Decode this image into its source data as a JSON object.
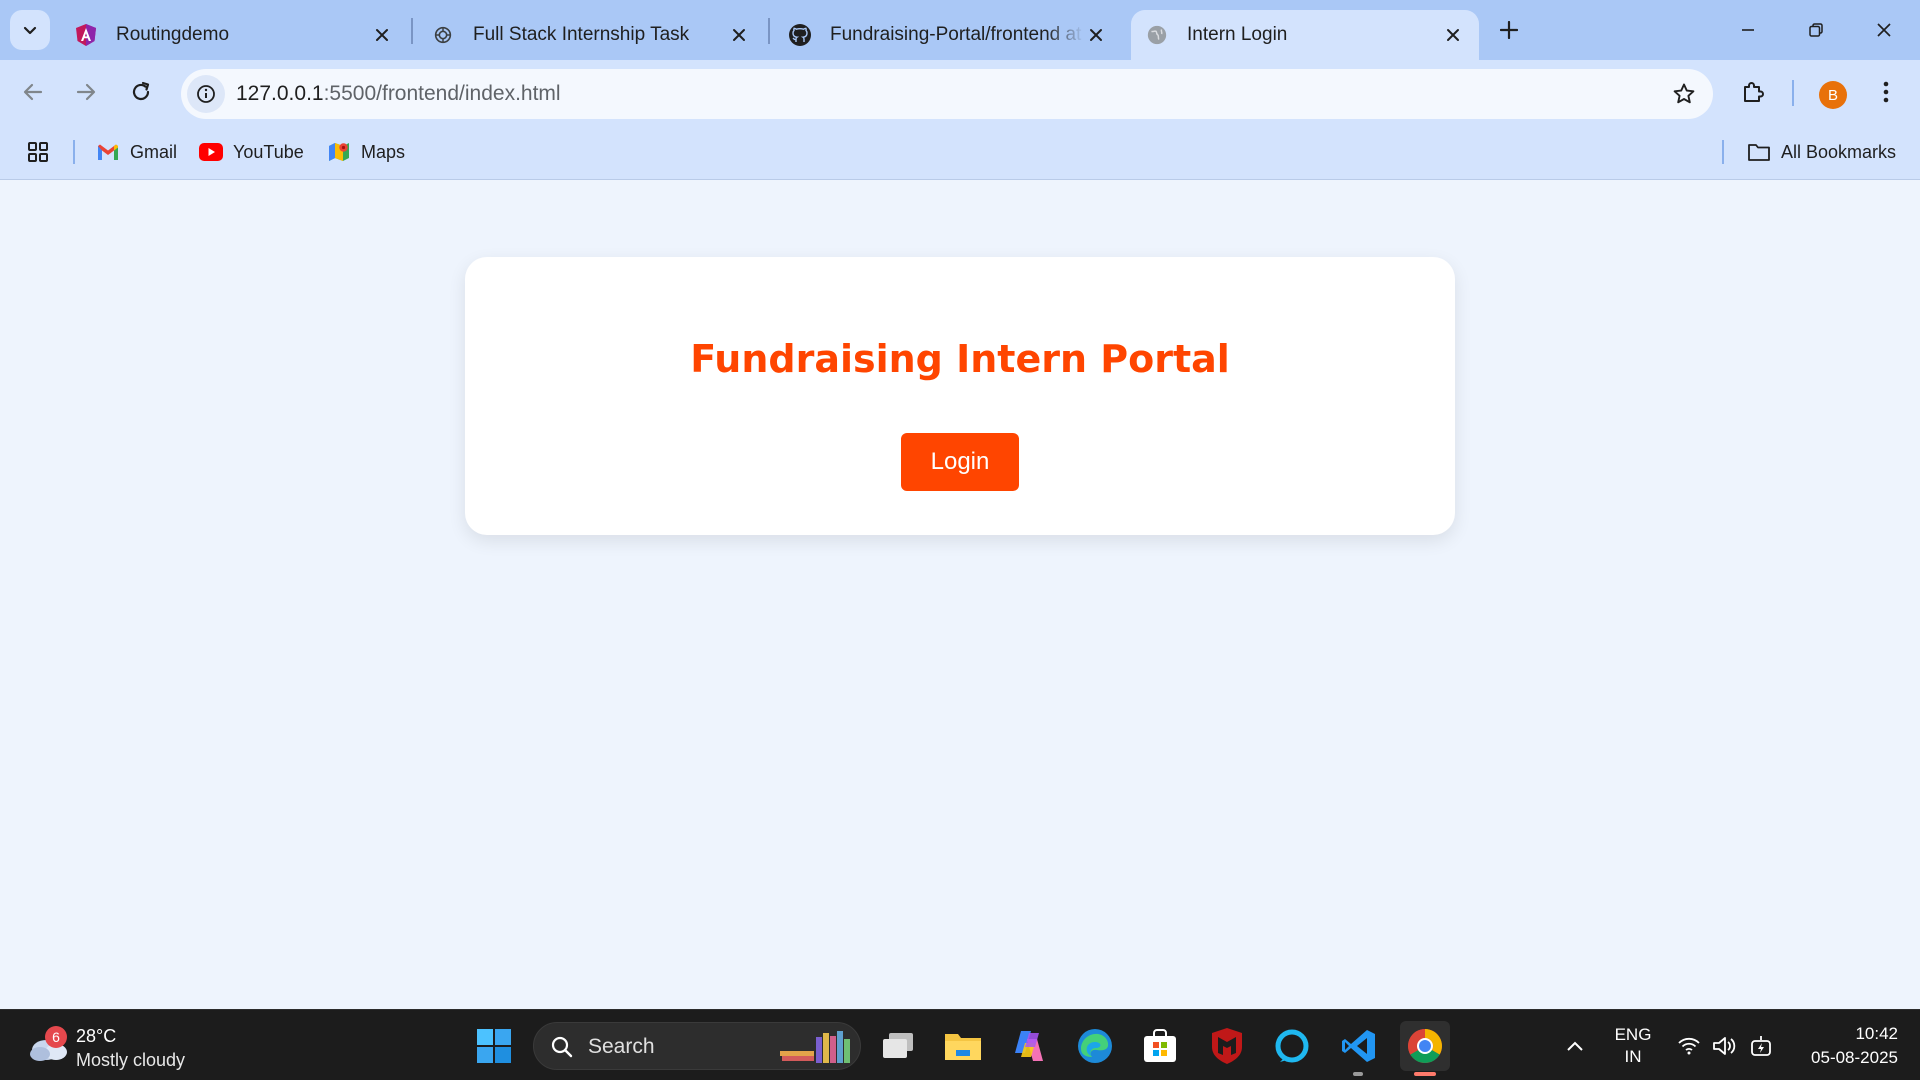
{
  "browser": {
    "tabs": [
      {
        "title": "Routingdemo",
        "active": false,
        "icon": "angular-icon"
      },
      {
        "title": "Full Stack Internship Task",
        "active": false,
        "icon": "openai-icon"
      },
      {
        "title": "Fundraising-Portal/frontend at ma",
        "active": false,
        "icon": "github-icon"
      },
      {
        "title": "Intern Login",
        "active": true,
        "icon": "globe-icon"
      }
    ],
    "address": {
      "host": "127.0.0.1",
      "path": ":5500/frontend/index.html"
    },
    "profile_initial": "B",
    "bookmarks": [
      {
        "label": "Gmail",
        "icon": "gmail-icon"
      },
      {
        "label": "YouTube",
        "icon": "youtube-icon"
      },
      {
        "label": "Maps",
        "icon": "maps-icon"
      }
    ],
    "all_bookmarks_label": "All Bookmarks"
  },
  "page": {
    "title": "Fundraising Intern Portal",
    "login_label": "Login"
  },
  "taskbar": {
    "weather": {
      "badge": "6",
      "temp": "28°C",
      "condition": "Mostly cloudy"
    },
    "search_placeholder": "Search",
    "language": {
      "line1": "ENG",
      "line2": "IN"
    },
    "clock": {
      "time": "10:42",
      "date": "05-08-2025"
    }
  },
  "colors": {
    "accent": "#ff4500",
    "page_background": "#eef4fd",
    "chrome_frame": "#aac8f6",
    "toolbar": "#d3e3fd",
    "taskbar": "#1c1c1c"
  }
}
